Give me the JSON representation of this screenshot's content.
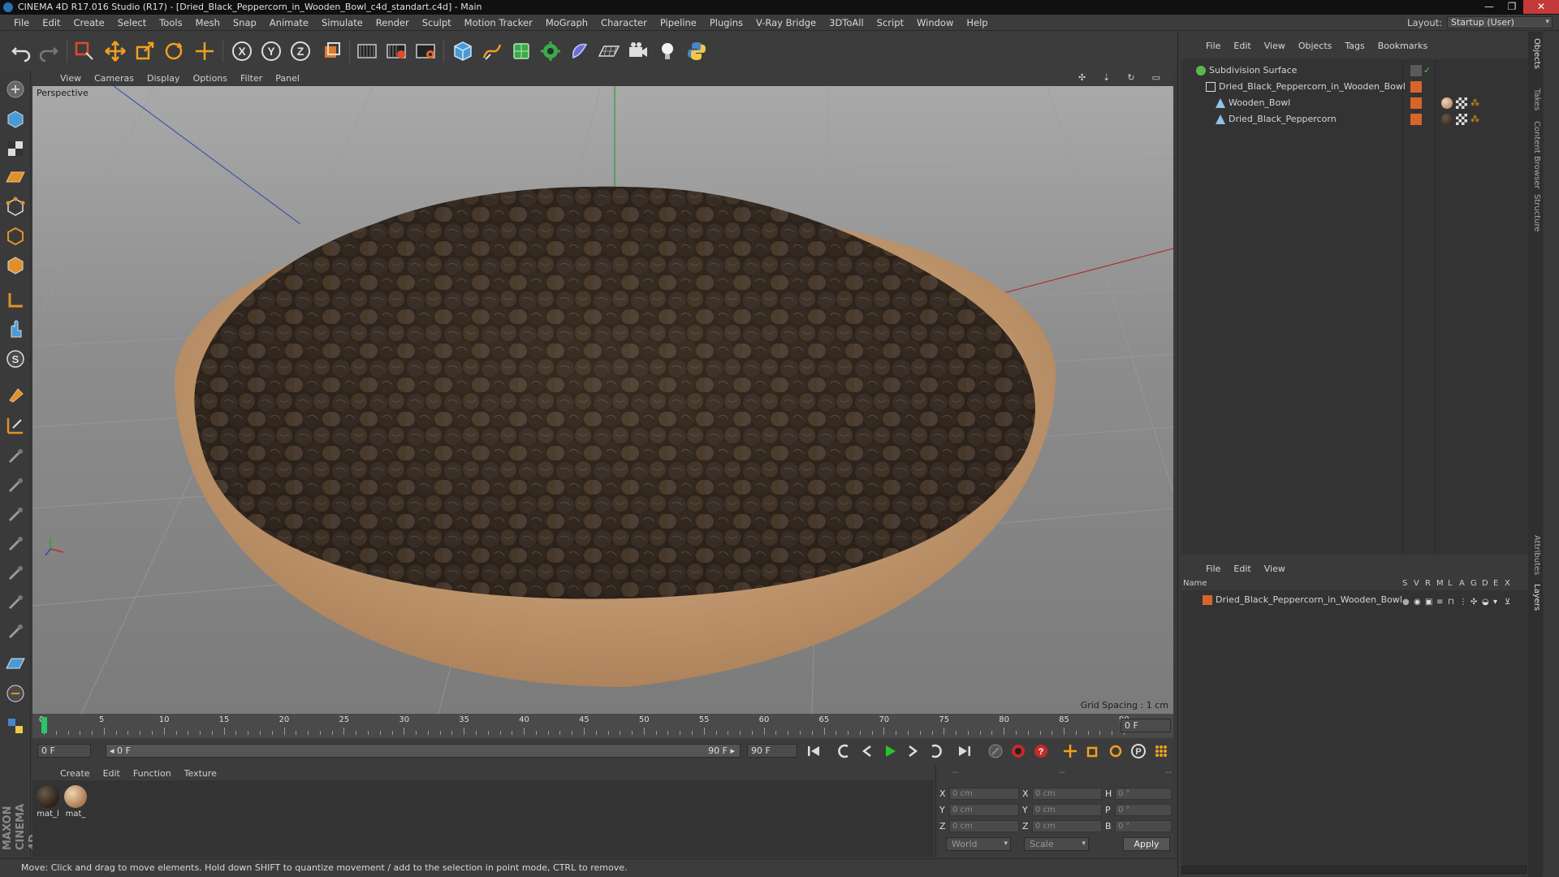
{
  "window": {
    "title": "CINEMA 4D R17.016 Studio (R17) - [Dried_Black_Peppercorn_in_Wooden_Bowl_c4d_standart.c4d] - Main",
    "min": "—",
    "max": "❐",
    "close": "✕"
  },
  "menubar": {
    "items": [
      "File",
      "Edit",
      "Create",
      "Select",
      "Tools",
      "Mesh",
      "Snap",
      "Animate",
      "Simulate",
      "Render",
      "Sculpt",
      "Motion Tracker",
      "MoGraph",
      "Character",
      "Pipeline",
      "Plugins",
      "V-Ray Bridge",
      "3DToAll",
      "Script",
      "Window",
      "Help"
    ],
    "layout_label": "Layout:",
    "layout_value": "Startup (User)"
  },
  "viewport": {
    "menu": [
      "View",
      "Cameras",
      "Display",
      "Options",
      "Filter",
      "Panel"
    ],
    "label": "Perspective",
    "grid_spacing": "Grid Spacing : 1 cm",
    "nav": [
      "✣",
      "⇣",
      "↻",
      "▭"
    ]
  },
  "timeline": {
    "ticks": [
      "0",
      "5",
      "10",
      "15",
      "20",
      "25",
      "30",
      "35",
      "40",
      "45",
      "50",
      "55",
      "60",
      "65",
      "70",
      "75",
      "80",
      "85",
      "90"
    ],
    "end_frame": "0 F"
  },
  "transport": {
    "current": "0 F",
    "range_start": "◂ 0 F",
    "range_end": "90 F ▸",
    "max_frame": "90 F"
  },
  "material_manager": {
    "menu": [
      "Create",
      "Edit",
      "Function",
      "Texture"
    ],
    "materials": [
      {
        "label": "mat_l",
        "color": "#3a3028"
      },
      {
        "label": "mat_",
        "color": "#c9a37a"
      }
    ]
  },
  "coordinates": {
    "heads": [
      "--",
      "--",
      "--"
    ],
    "rows": [
      {
        "a": "X",
        "av": "0 cm",
        "b": "X",
        "bv": "0 cm",
        "c": "H",
        "cv": "0 °"
      },
      {
        "a": "Y",
        "av": "0 cm",
        "b": "Y",
        "bv": "0 cm",
        "c": "P",
        "cv": "0 °"
      },
      {
        "a": "Z",
        "av": "0 cm",
        "b": "Z",
        "bv": "0 cm",
        "c": "B",
        "cv": "0 °"
      }
    ],
    "world": "World",
    "scale": "Scale",
    "apply": "Apply"
  },
  "status": "Move: Click and drag to move elements. Hold down SHIFT to quantize movement / add to the selection in point mode, CTRL to remove.",
  "object_manager": {
    "menu": [
      "File",
      "Edit",
      "View",
      "Objects",
      "Tags",
      "Bookmarks"
    ],
    "objects": [
      {
        "name": "Subdivision Surface",
        "indent": 0,
        "icon_color": "#59b84a"
      },
      {
        "name": "Dried_Black_Peppercorn_in_Wooden_Bowl",
        "indent": 1,
        "icon_color": "#d9d9d9"
      },
      {
        "name": "Wooden_Bowl",
        "indent": 2,
        "icon_color": "#8ec3e8"
      },
      {
        "name": "Dried_Black_Peppercorn",
        "indent": 2,
        "icon_color": "#8ec3e8"
      }
    ]
  },
  "layer_manager": {
    "menu": [
      "File",
      "Edit",
      "View"
    ],
    "header_name": "Name",
    "cols": [
      "S",
      "V",
      "R",
      "M",
      "L",
      "A",
      "G",
      "D",
      "E",
      "X"
    ],
    "layers": [
      {
        "name": "Dried_Black_Peppercorn_in_Wooden_Bowl",
        "color": "#d8642a"
      }
    ]
  },
  "side_tabs": [
    "Objects",
    "Takes",
    "Content Browser",
    "Structure",
    "Attributes",
    "Layers"
  ],
  "colors": {
    "accent": "#2b6fb5",
    "viewport_bg": "#8e8e8e",
    "bowl": "#c9a37a",
    "peppercorn": "#3a3028"
  }
}
